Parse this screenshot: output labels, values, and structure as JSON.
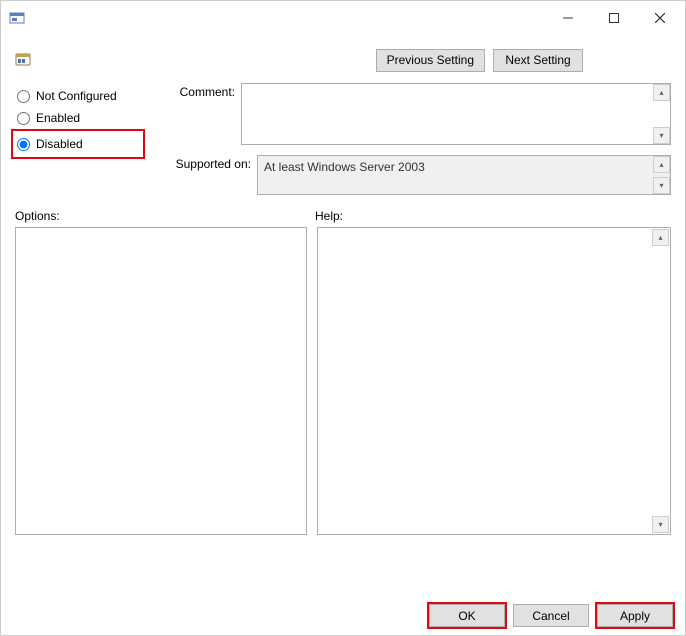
{
  "window": {
    "title": ""
  },
  "nav": {
    "previous": "Previous Setting",
    "next": "Next Setting"
  },
  "radios": {
    "not_configured": "Not Configured",
    "enabled": "Enabled",
    "disabled": "Disabled",
    "selected": "disabled"
  },
  "fields": {
    "comment_label": "Comment:",
    "comment_value": "",
    "supported_label": "Supported on:",
    "supported_value": "At least Windows Server 2003"
  },
  "sections": {
    "options_label": "Options:",
    "help_label": "Help:",
    "options_content": "",
    "help_content": ""
  },
  "footer": {
    "ok": "OK",
    "cancel": "Cancel",
    "apply": "Apply"
  }
}
